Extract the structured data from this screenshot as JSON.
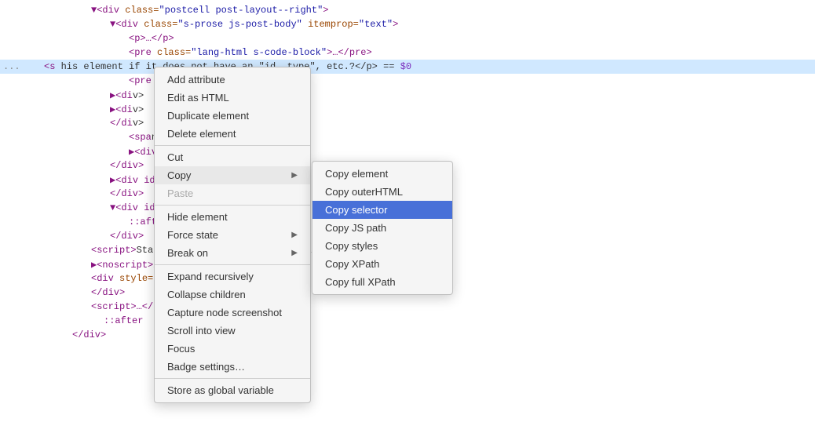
{
  "colors": {
    "highlight": "#d0e8ff",
    "selectedMenu": "#4870d8",
    "background": "#ffffff",
    "menuBg": "#f5f5f5"
  },
  "codeLines": [
    {
      "indent": 4,
      "content": "<div class=\"postcell post-layout--right\">",
      "type": "tag"
    },
    {
      "indent": 6,
      "content": "<div class=\"s-prose js-post-body\" itemprop=\"text\">",
      "type": "tag"
    },
    {
      "indent": 8,
      "content": "<p>…</p>",
      "type": "tag"
    },
    {
      "indent": 8,
      "content": "<pre class=\"lang-html s-code-block\">…</pre>",
      "type": "tag"
    }
  ],
  "contextMenu": {
    "items": [
      {
        "id": "add-attribute",
        "label": "Add attribute",
        "hasArrow": false,
        "disabled": false
      },
      {
        "id": "edit-html",
        "label": "Edit as HTML",
        "hasArrow": false,
        "disabled": false
      },
      {
        "id": "duplicate-element",
        "label": "Duplicate element",
        "hasArrow": false,
        "disabled": false
      },
      {
        "id": "delete-element",
        "label": "Delete element",
        "hasArrow": false,
        "disabled": false
      },
      {
        "id": "separator1",
        "type": "separator"
      },
      {
        "id": "cut",
        "label": "Cut",
        "hasArrow": false,
        "disabled": false
      },
      {
        "id": "copy",
        "label": "Copy",
        "hasArrow": true,
        "disabled": false,
        "active": false
      },
      {
        "id": "paste",
        "label": "Paste",
        "hasArrow": false,
        "disabled": true
      },
      {
        "id": "separator2",
        "type": "separator"
      },
      {
        "id": "hide-element",
        "label": "Hide element",
        "hasArrow": false,
        "disabled": false
      },
      {
        "id": "force-state",
        "label": "Force state",
        "hasArrow": true,
        "disabled": false
      },
      {
        "id": "break-on",
        "label": "Break on",
        "hasArrow": true,
        "disabled": false
      },
      {
        "id": "separator3",
        "type": "separator"
      },
      {
        "id": "expand-recursively",
        "label": "Expand recursively",
        "hasArrow": false,
        "disabled": false
      },
      {
        "id": "collapse-children",
        "label": "Collapse children",
        "hasArrow": false,
        "disabled": false
      },
      {
        "id": "capture-screenshot",
        "label": "Capture node screenshot",
        "hasArrow": false,
        "disabled": false
      },
      {
        "id": "scroll-into-view",
        "label": "Scroll into view",
        "hasArrow": false,
        "disabled": false
      },
      {
        "id": "focus",
        "label": "Focus",
        "hasArrow": false,
        "disabled": false
      },
      {
        "id": "badge-settings",
        "label": "Badge settings…",
        "hasArrow": false,
        "disabled": false
      },
      {
        "id": "separator4",
        "type": "separator"
      },
      {
        "id": "store-global",
        "label": "Store as global variable",
        "hasArrow": false,
        "disabled": false
      }
    ]
  },
  "copySubmenu": {
    "items": [
      {
        "id": "copy-element",
        "label": "Copy element",
        "active": false
      },
      {
        "id": "copy-outerhtml",
        "label": "Copy outerHTML",
        "active": false
      },
      {
        "id": "copy-selector",
        "label": "Copy selector",
        "active": true
      },
      {
        "id": "copy-js-path",
        "label": "Copy JS path",
        "active": false
      },
      {
        "id": "copy-styles",
        "label": "Copy styles",
        "active": false
      },
      {
        "id": "copy-xpath",
        "label": "Copy XPath",
        "active": false
      },
      {
        "id": "copy-full-xpath",
        "label": "Copy full XPath",
        "active": false
      }
    ]
  }
}
